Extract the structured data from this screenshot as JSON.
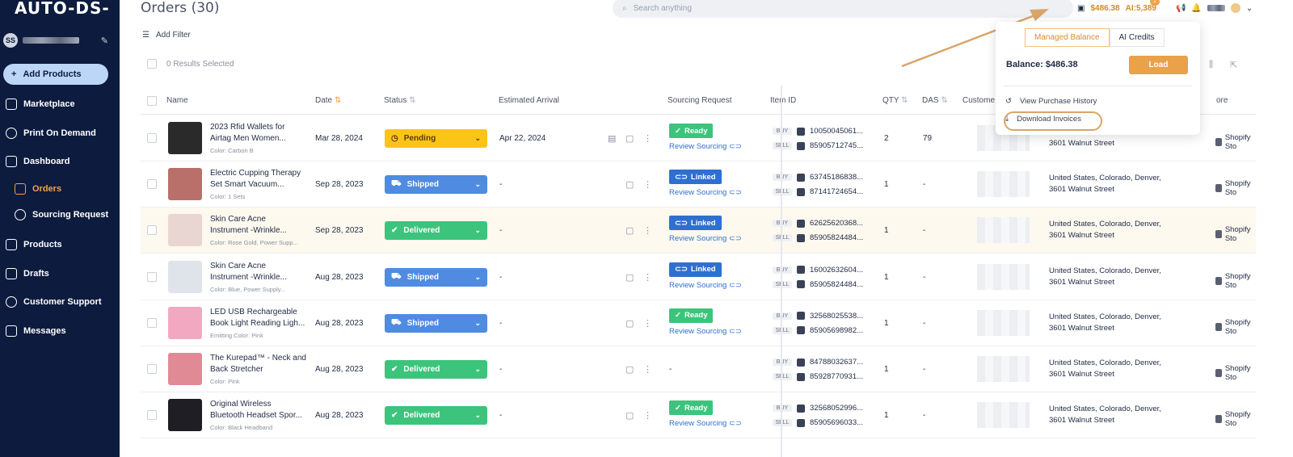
{
  "app": {
    "logo": "AUTO-DS-",
    "user_initials": "SS"
  },
  "sidebar": {
    "add_products": "Add Products",
    "items": [
      {
        "label": "Marketplace",
        "active": false,
        "sub": false
      },
      {
        "label": "Print On Demand",
        "active": false,
        "sub": false
      },
      {
        "label": "Dashboard",
        "active": false,
        "sub": false
      },
      {
        "label": "Orders",
        "active": true,
        "sub": true
      },
      {
        "label": "Sourcing Request",
        "active": false,
        "sub": true
      },
      {
        "label": "Products",
        "active": false,
        "sub": false
      },
      {
        "label": "Drafts",
        "active": false,
        "sub": false
      },
      {
        "label": "Customer Support",
        "active": false,
        "sub": false
      },
      {
        "label": "Messages",
        "active": false,
        "sub": false
      }
    ]
  },
  "header": {
    "title": "Orders (30)",
    "search_placeholder": "Search anything",
    "balance": "$486.38",
    "ai_label": "AI:5,389",
    "notif_count": "1"
  },
  "toolbar": {
    "add_filter": "Add Filter",
    "selected": "0 Results Selected"
  },
  "table": {
    "headers": {
      "name": "Name",
      "date": "Date",
      "status": "Status",
      "arrival": "Estimated Arrival",
      "sourcing": "Sourcing Request",
      "item_id": "Item ID",
      "qty": "QTY",
      "das": "DAS",
      "customer": "Custome",
      "store": "ore"
    },
    "buy_tag": "BUY",
    "sell_tag": "SELL",
    "review": "Review Sourcing",
    "rows": [
      {
        "name": "2023 Rfid Wallets for\nAirtag Men Women...",
        "variant": "Color: Carbon B",
        "date": "Mar 28, 2024",
        "status": "Pending",
        "arrival": "Apr 22, 2024",
        "sourcing": "Ready",
        "buy_id": "10050045061...",
        "sell_id": "85905712745...",
        "qty": "2",
        "das": "79",
        "addr": "3601 Walnut Street",
        "store": "Shopify Sto",
        "img": "#2a2a2a"
      },
      {
        "name": "Electric Cupping Therapy\nSet Smart Vacuum...",
        "variant": "Color: 1 Sets",
        "date": "Sep 28, 2023",
        "status": "Shipped",
        "arrival": "-",
        "sourcing": "Linked",
        "buy_id": "63745186838...",
        "sell_id": "87141724654...",
        "qty": "1",
        "das": "-",
        "addr": "United States, Colorado, Denver,\n3601 Walnut Street",
        "store": "Shopify Sto",
        "img": "#b9706a"
      },
      {
        "name": "Skin Care Acne\nInstrument -Wrinkle...",
        "variant": "Color: Rose Gold, Power Supp...",
        "date": "Sep 28, 2023",
        "status": "Delivered",
        "arrival": "-",
        "sourcing": "Linked",
        "buy_id": "62625620368...",
        "sell_id": "85905824484...",
        "qty": "1",
        "das": "-",
        "addr": "United States, Colorado, Denver,\n3601 Walnut Street",
        "store": "Shopify Sto",
        "img": "#e9d6d2"
      },
      {
        "name": "Skin Care Acne\nInstrument -Wrinkle...",
        "variant": "Color: Blue, Power Supply...",
        "date": "Aug 28, 2023",
        "status": "Shipped",
        "arrival": "-",
        "sourcing": "Linked",
        "buy_id": "16002632604...",
        "sell_id": "85905824484...",
        "qty": "1",
        "das": "-",
        "addr": "United States, Colorado, Denver,\n3601 Walnut Street",
        "store": "Shopify Sto",
        "img": "#dfe3ea"
      },
      {
        "name": "LED USB Rechargeable\nBook Light Reading Ligh...",
        "variant": "Emitting Color: Pink",
        "date": "Aug 28, 2023",
        "status": "Shipped",
        "arrival": "-",
        "sourcing": "Ready",
        "buy_id": "32568025538...",
        "sell_id": "85905698982...",
        "qty": "1",
        "das": "-",
        "addr": "United States, Colorado, Denver,\n3601 Walnut Street",
        "store": "Shopify Sto",
        "img": "#f2a8c0"
      },
      {
        "name": "The Kurepad™ - Neck and\nBack Stretcher",
        "variant": "Color: Pink",
        "date": "Aug 28, 2023",
        "status": "Delivered",
        "arrival": "-",
        "sourcing": "-",
        "buy_id": "84788032637...",
        "sell_id": "85928770931...",
        "qty": "1",
        "das": "-",
        "addr": "United States, Colorado, Denver,\n3601 Walnut Street",
        "store": "Shopify Sto",
        "img": "#e08a96"
      },
      {
        "name": "Original Wireless\nBluetooth Headset Spor...",
        "variant": "Color: Black Headband",
        "date": "Aug 28, 2023",
        "status": "Delivered",
        "arrival": "-",
        "sourcing": "Ready",
        "buy_id": "32568052996...",
        "sell_id": "85905696033...",
        "qty": "1",
        "das": "-",
        "addr": "United States, Colorado, Denver,\n3601 Walnut Street",
        "store": "Shopify Sto",
        "img": "#1e1e24"
      }
    ]
  },
  "dropdown": {
    "tab_managed": "Managed Balance",
    "tab_ai": "AI Credits",
    "balance": "Balance: $486.38",
    "load": "Load",
    "history": "View Purchase History",
    "download": "Download Invoices"
  },
  "colors": {
    "sidebar": "#0d1b3e",
    "accent": "#f0a24a",
    "pending": "#fcc419",
    "shipped": "#4f8be0",
    "delivered": "#3cc47c",
    "linked": "#2f6fd1"
  }
}
